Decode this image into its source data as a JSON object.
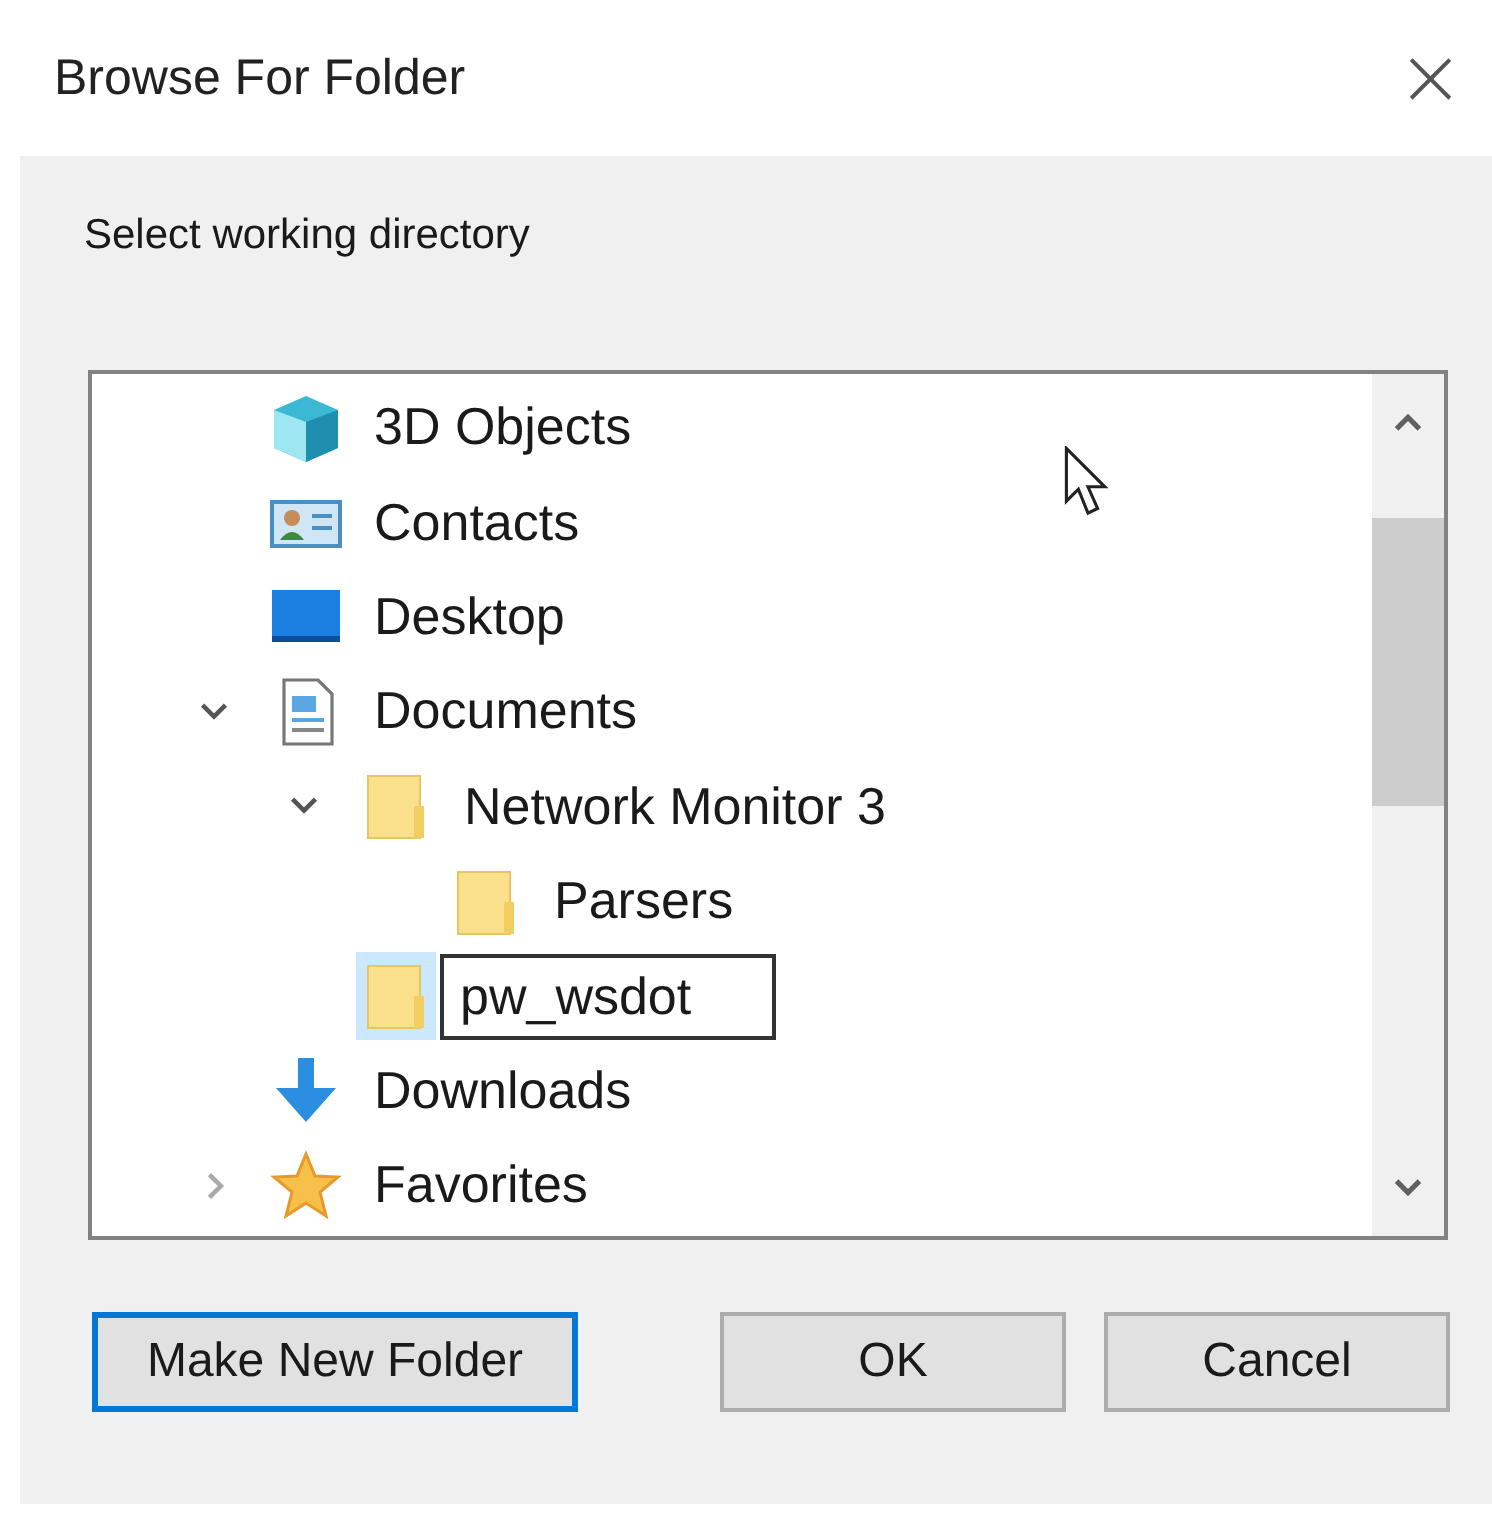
{
  "window": {
    "title": "Browse For Folder",
    "close": "×"
  },
  "prompt": "Select working directory",
  "tree": {
    "items": [
      {
        "label": "3D Objects",
        "kind": "cube",
        "selected": false,
        "editing": false
      },
      {
        "label": "Contacts",
        "kind": "contact-card",
        "selected": false,
        "editing": false
      },
      {
        "label": "Desktop",
        "kind": "desktop",
        "selected": false,
        "editing": false
      },
      {
        "label": "Documents",
        "kind": "document",
        "selected": false,
        "editing": false,
        "expanded": true,
        "children": [
          {
            "label": "Network Monitor 3",
            "kind": "folder",
            "selected": false,
            "editing": false,
            "expanded": true,
            "children": [
              {
                "label": "Parsers",
                "kind": "folder",
                "selected": false,
                "editing": false
              }
            ]
          },
          {
            "label": "pw_wsdot",
            "kind": "folder",
            "selected": true,
            "editing": true
          }
        ]
      },
      {
        "label": "Downloads",
        "kind": "download",
        "selected": false,
        "editing": false
      },
      {
        "label": "Favorites",
        "kind": "star",
        "selected": false,
        "editing": false,
        "expanded": false
      }
    ]
  },
  "buttons": [
    {
      "label": "Make New Folder",
      "focused": true
    },
    {
      "label": "OK",
      "focused": false
    },
    {
      "label": "Cancel",
      "focused": false
    }
  ]
}
